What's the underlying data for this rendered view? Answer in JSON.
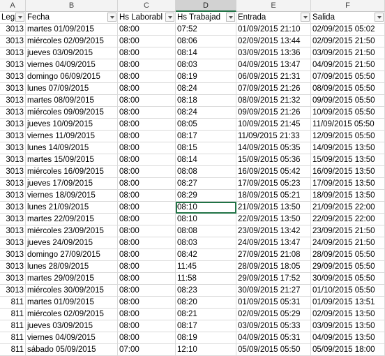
{
  "columns": [
    "A",
    "B",
    "C",
    "D",
    "E",
    "F"
  ],
  "headers": [
    "Lega",
    "Fecha",
    "Hs Laborabl",
    "Hs Trabajad",
    "Entrada",
    "Salida"
  ],
  "rows": [
    [
      "3013",
      "martes 01/09/2015",
      "08:00",
      "07:52",
      "01/09/2015 21:10",
      "02/09/2015 05:02"
    ],
    [
      "3013",
      "miércoles 02/09/2015",
      "08:00",
      "08:06",
      "02/09/2015 13:44",
      "02/09/2015 21:50"
    ],
    [
      "3013",
      "jueves 03/09/2015",
      "08:00",
      "08:14",
      "03/09/2015 13:36",
      "03/09/2015 21:50"
    ],
    [
      "3013",
      "viernes 04/09/2015",
      "08:00",
      "08:03",
      "04/09/2015 13:47",
      "04/09/2015 21:50"
    ],
    [
      "3013",
      "domingo 06/09/2015",
      "08:00",
      "08:19",
      "06/09/2015 21:31",
      "07/09/2015 05:50"
    ],
    [
      "3013",
      "lunes 07/09/2015",
      "08:00",
      "08:24",
      "07/09/2015 21:26",
      "08/09/2015 05:50"
    ],
    [
      "3013",
      "martes 08/09/2015",
      "08:00",
      "08:18",
      "08/09/2015 21:32",
      "09/09/2015 05:50"
    ],
    [
      "3013",
      "miércoles 09/09/2015",
      "08:00",
      "08:24",
      "09/09/2015 21:26",
      "10/09/2015 05:50"
    ],
    [
      "3013",
      "jueves 10/09/2015",
      "08:00",
      "08:05",
      "10/09/2015 21:45",
      "11/09/2015 05:50"
    ],
    [
      "3013",
      "viernes 11/09/2015",
      "08:00",
      "08:17",
      "11/09/2015 21:33",
      "12/09/2015 05:50"
    ],
    [
      "3013",
      "lunes 14/09/2015",
      "08:00",
      "08:15",
      "14/09/2015 05:35",
      "14/09/2015 13:50"
    ],
    [
      "3013",
      "martes 15/09/2015",
      "08:00",
      "08:14",
      "15/09/2015 05:36",
      "15/09/2015 13:50"
    ],
    [
      "3013",
      "miércoles 16/09/2015",
      "08:00",
      "08:08",
      "16/09/2015 05:42",
      "16/09/2015 13:50"
    ],
    [
      "3013",
      "jueves 17/09/2015",
      "08:00",
      "08:27",
      "17/09/2015 05:23",
      "17/09/2015 13:50"
    ],
    [
      "3013",
      "viernes 18/09/2015",
      "08:00",
      "08:29",
      "18/09/2015 05:21",
      "18/09/2015 13:50"
    ],
    [
      "3013",
      "lunes 21/09/2015",
      "08:00",
      "08:10",
      "21/09/2015 13:50",
      "21/09/2015 22:00"
    ],
    [
      "3013",
      "martes 22/09/2015",
      "08:00",
      "08:10",
      "22/09/2015 13:50",
      "22/09/2015 22:00"
    ],
    [
      "3013",
      "miércoles 23/09/2015",
      "08:00",
      "08:08",
      "23/09/2015 13:42",
      "23/09/2015 21:50"
    ],
    [
      "3013",
      "jueves 24/09/2015",
      "08:00",
      "08:03",
      "24/09/2015 13:47",
      "24/09/2015 21:50"
    ],
    [
      "3013",
      "domingo 27/09/2015",
      "08:00",
      "08:42",
      "27/09/2015 21:08",
      "28/09/2015 05:50"
    ],
    [
      "3013",
      "lunes 28/09/2015",
      "08:00",
      "11:45",
      "28/09/2015 18:05",
      "29/09/2015 05:50"
    ],
    [
      "3013",
      "martes 29/09/2015",
      "08:00",
      "11:58",
      "29/09/2015 17:52",
      "30/09/2015 05:50"
    ],
    [
      "3013",
      "miércoles 30/09/2015",
      "08:00",
      "08:23",
      "30/09/2015 21:27",
      "01/10/2015 05:50"
    ],
    [
      "811",
      "martes 01/09/2015",
      "08:00",
      "08:20",
      "01/09/2015 05:31",
      "01/09/2015 13:51"
    ],
    [
      "811",
      "miércoles 02/09/2015",
      "08:00",
      "08:21",
      "02/09/2015 05:29",
      "02/09/2015 13:50"
    ],
    [
      "811",
      "jueves 03/09/2015",
      "08:00",
      "08:17",
      "03/09/2015 05:33",
      "03/09/2015 13:50"
    ],
    [
      "811",
      "viernes 04/09/2015",
      "08:00",
      "08:19",
      "04/09/2015 05:31",
      "04/09/2015 13:50"
    ],
    [
      "811",
      "sábado 05/09/2015",
      "07:00",
      "12:10",
      "05/09/2015 05:50",
      "05/09/2015 18:00"
    ]
  ],
  "selected_column": "D",
  "active_row_index": 15
}
